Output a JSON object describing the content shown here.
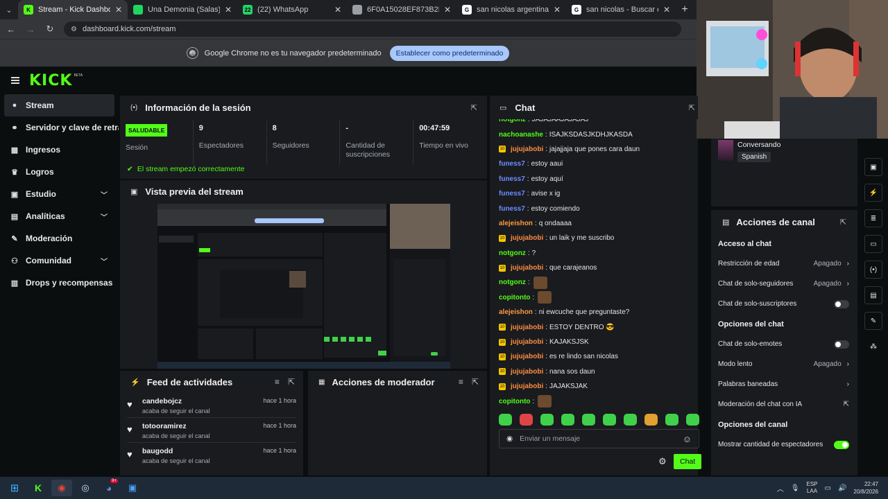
{
  "browser": {
    "tabs": [
      {
        "title": "Stream - Kick Dashboard",
        "fav": "K",
        "color": "#53fc18",
        "active": true
      },
      {
        "title": "Una Demonia (Salas) • xpe...",
        "fav": "",
        "color": "#1ed760",
        "active": false
      },
      {
        "title": "(22) WhatsApp",
        "fav": "22",
        "color": "#25d366",
        "active": false
      },
      {
        "title": "6F0A15028EF873B2F02E9EBCF4...",
        "fav": "",
        "color": "#9aa0a6",
        "active": false
      },
      {
        "title": "san nicolas argentina - Buscar c...",
        "fav": "G",
        "color": "#ffffff",
        "active": false
      },
      {
        "title": "san nicolas - Buscar con Google",
        "fav": "G",
        "color": "#ffffff",
        "active": false
      }
    ],
    "url": "dashboard.kick.com/stream",
    "infobar_text": "Google Chrome no es tu navegador predeterminado",
    "infobar_button": "Establecer como predeterminado"
  },
  "kick": {
    "logo": "KICK",
    "beta": "BETA"
  },
  "sidebar": {
    "items": [
      {
        "label": "Stream",
        "icon": "●",
        "active": true,
        "chev": ""
      },
      {
        "label": "Servidor y clave de retransmisión",
        "icon": "⚭",
        "active": false,
        "chev": ""
      },
      {
        "label": "Ingresos",
        "icon": "▦",
        "active": false,
        "chev": ""
      },
      {
        "label": "Logros",
        "icon": "♛",
        "active": false,
        "chev": ""
      },
      {
        "label": "Estudio",
        "icon": "▣",
        "active": false,
        "chev": "﹀"
      },
      {
        "label": "Analíticas",
        "icon": "▤",
        "active": false,
        "chev": "﹀"
      },
      {
        "label": "Moderación",
        "icon": "✎",
        "active": false,
        "chev": ""
      },
      {
        "label": "Comunidad",
        "icon": "⚇",
        "active": false,
        "chev": "﹀"
      },
      {
        "label": "Drops y recompensas",
        "icon": "▥",
        "active": false,
        "chev": ""
      }
    ]
  },
  "session": {
    "title": "Información de la sesión",
    "badge": "SALUDABLE",
    "stats": [
      {
        "value": "",
        "label": "Sesión"
      },
      {
        "value": "9",
        "label": "Espectadores"
      },
      {
        "value": "8",
        "label": "Seguidores"
      },
      {
        "value": "-",
        "label": "Cantidad de suscripciones"
      },
      {
        "value": "00:47:59",
        "label": "Tiempo en vivo"
      }
    ],
    "ok_message": "El stream empezó correctamente"
  },
  "preview": {
    "title": "Vista previa del stream"
  },
  "feed": {
    "title": "Feed de actividades",
    "items": [
      {
        "name": "candebojcz",
        "desc": "acaba de seguir el canal",
        "time": "hace 1 hora"
      },
      {
        "name": "totooramirez",
        "desc": "acaba de seguir el canal",
        "time": "hace 1 hora"
      },
      {
        "name": "baugodd",
        "desc": "acaba de seguir el canal",
        "time": "hace 1 hora"
      }
    ]
  },
  "mod_actions": {
    "title": "Acciones de moderador"
  },
  "chat": {
    "title": "Chat",
    "messages": [
      {
        "user": "notgonz",
        "color": "#53fc18",
        "text": "JAJAJAAJAJAJAJ",
        "badge": false,
        "emote": false
      },
      {
        "user": "nachoanashe",
        "color": "#53fc18",
        "text": "ISAJKSDASJKDHJKASDA",
        "badge": false,
        "emote": false
      },
      {
        "user": "jujujabobi",
        "color": "#ff8c42",
        "text": "jajajjaja que pones cara daun",
        "badge": true,
        "emote": false
      },
      {
        "user": "funess7",
        "color": "#6f8cff",
        "text": "estoy aaui",
        "badge": false,
        "emote": false
      },
      {
        "user": "funess7",
        "color": "#6f8cff",
        "text": "estoy aquí",
        "badge": false,
        "emote": false
      },
      {
        "user": "funess7",
        "color": "#6f8cff",
        "text": "avise x ig",
        "badge": false,
        "emote": false
      },
      {
        "user": "funess7",
        "color": "#6f8cff",
        "text": "estoy comiendo",
        "badge": false,
        "emote": false
      },
      {
        "user": "alejeishon",
        "color": "#ff9a3c",
        "text": "q ondaaaa",
        "badge": false,
        "emote": false
      },
      {
        "user": "jujujabobi",
        "color": "#ff8c42",
        "text": "un laik y me suscribo",
        "badge": true,
        "emote": false
      },
      {
        "user": "notgonz",
        "color": "#53fc18",
        "text": "?",
        "badge": false,
        "emote": false
      },
      {
        "user": "jujujabobi",
        "color": "#ff8c42",
        "text": "que carajeanos",
        "badge": true,
        "emote": false
      },
      {
        "user": "notgonz",
        "color": "#53fc18",
        "text": "",
        "badge": false,
        "emote": true
      },
      {
        "user": "copitonto",
        "color": "#53fc18",
        "text": "",
        "badge": false,
        "emote": true
      },
      {
        "user": "alejeishon",
        "color": "#ff9a3c",
        "text": "ni ewcuche que preguntaste?",
        "badge": false,
        "emote": false
      },
      {
        "user": "jujujabobi",
        "color": "#ff8c42",
        "text": "ESTOY DENTRO 😎",
        "badge": true,
        "emote": false
      },
      {
        "user": "jujujabobi",
        "color": "#ff8c42",
        "text": "KAJAKSJSK",
        "badge": true,
        "emote": false
      },
      {
        "user": "jujujabobi",
        "color": "#ff8c42",
        "text": "es re lindo san nicolas",
        "badge": true,
        "emote": false
      },
      {
        "user": "jujujabobi",
        "color": "#ff8c42",
        "text": "nana sos daun",
        "badge": true,
        "emote": false
      },
      {
        "user": "jujujabobi",
        "color": "#ff8c42",
        "text": "JAJAKSJAK",
        "badge": true,
        "emote": false
      },
      {
        "user": "copitonto",
        "color": "#53fc18",
        "text": "",
        "badge": false,
        "emote": true
      }
    ],
    "badge_label": "10",
    "input_placeholder": "Enviar un mensaje",
    "send_label": "Chat"
  },
  "stream_info": {
    "category": "Conversando",
    "language": "Spanish"
  },
  "channel_actions": {
    "title": "Acciones de canal",
    "sections": [
      {
        "title": "Acceso al chat",
        "rows": [
          {
            "label": "Restricción de edad",
            "status": "Apagado",
            "type": "arrow"
          },
          {
            "label": "Chat de solo-seguidores",
            "status": "Apagado",
            "type": "arrow"
          },
          {
            "label": "Chat de solo-suscriptores",
            "status": "",
            "type": "toggle-off"
          }
        ]
      },
      {
        "title": "Opciones del chat",
        "rows": [
          {
            "label": "Chat de solo-emotes",
            "status": "",
            "type": "toggle-off"
          },
          {
            "label": "Modo lento",
            "status": "Apagado",
            "type": "arrow"
          },
          {
            "label": "Palabras baneadas",
            "status": "",
            "type": "arrow"
          },
          {
            "label": "Moderación del chat con IA",
            "status": "",
            "type": "external"
          }
        ]
      },
      {
        "title": "Opciones del canal",
        "rows": [
          {
            "label": "Mostrar cantidad de espectadores",
            "status": "",
            "type": "toggle-on"
          }
        ]
      }
    ]
  },
  "taskbar": {
    "lang_top": "ESP",
    "lang_bottom": "LAA",
    "time": "22:47",
    "date": "20/8/2026",
    "discord_badge": "9+"
  },
  "colors": {
    "accent": "#53fc18",
    "panel": "#191b1f",
    "bg": "#0b0e0f"
  }
}
